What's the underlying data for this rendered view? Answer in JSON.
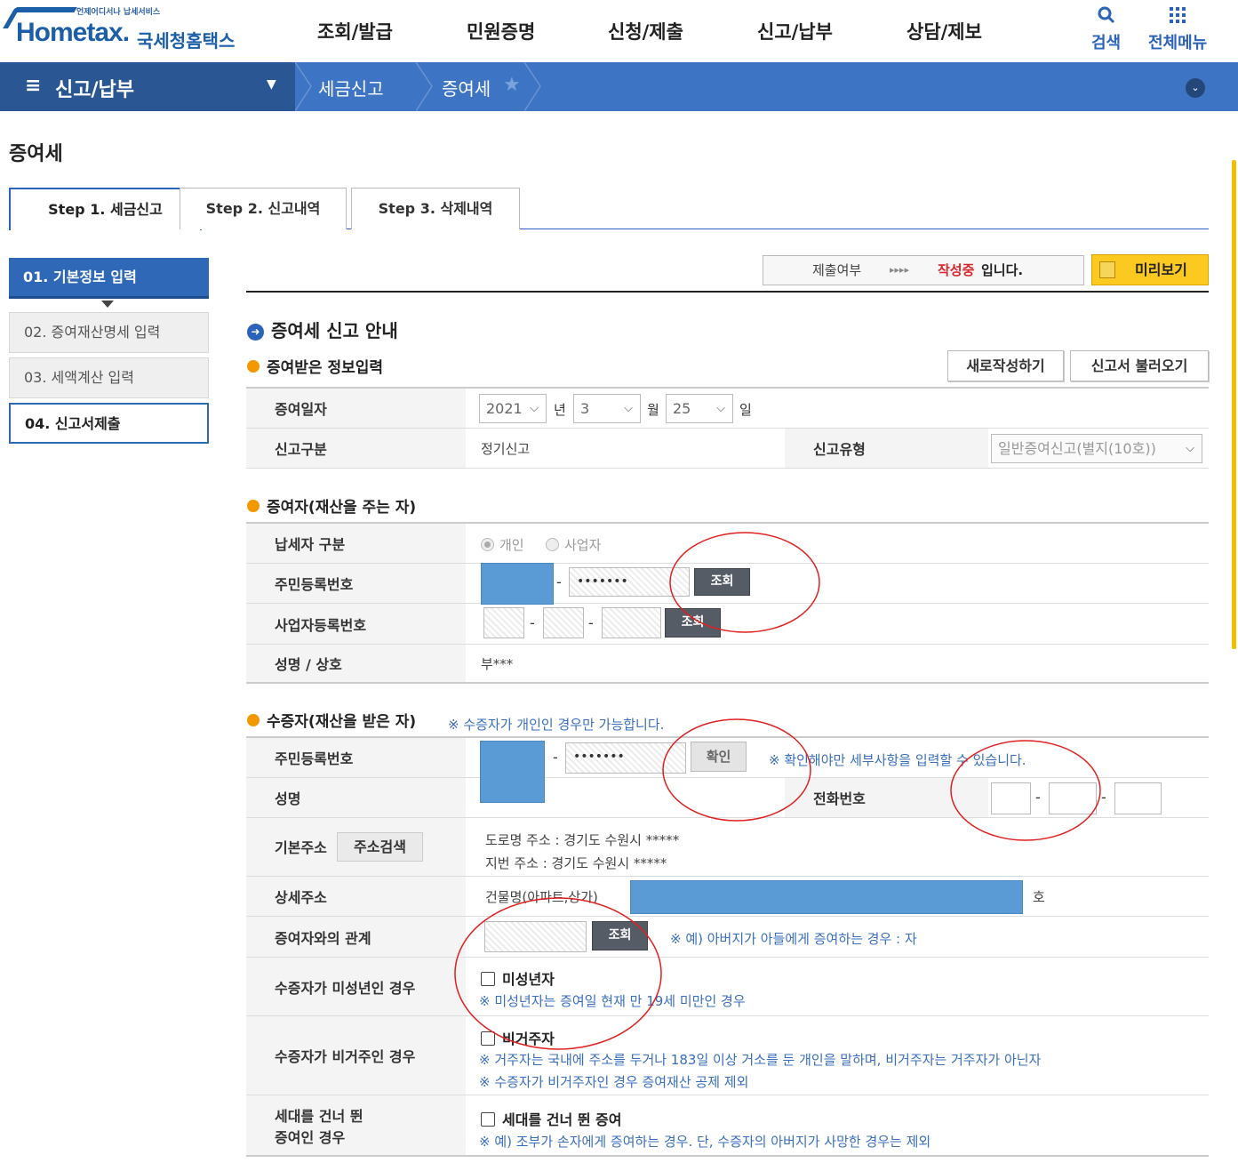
{
  "header": {
    "logo_sub": "언제어디서나 납세서비스",
    "logo_main": "Hometax.",
    "logo_kor": "국세청홈택스",
    "menu": [
      "조회/발급",
      "민원증명",
      "신청/제출",
      "신고/납부",
      "상담/제보"
    ],
    "search_label": "검색",
    "allmenu_label": "전체메뉴"
  },
  "nav": {
    "title": "신고/납부",
    "breadcrumb": [
      "세금신고",
      "증여세"
    ]
  },
  "page_title": "증여세",
  "tabs": [
    "Step 1. 세금신고",
    "Step 2. 신고내역",
    "Step 3. 삭제내역"
  ],
  "side_menu": [
    "01. 기본정보 입력",
    "02. 증여재산명세 입력",
    "03. 세액계산 입력",
    "04. 신고서제출"
  ],
  "status": {
    "label": "제출여부",
    "arrows": "▸▸▸▸",
    "value": "작성중",
    "suffix": "입니다.",
    "preview": "미리보기"
  },
  "section_title": "증여세 신고 안내",
  "info_section": {
    "title": "증여받은 정보입력",
    "new_btn": "새로작성하기",
    "load_btn": "신고서 불러오기",
    "date_label": "증여일자",
    "year": "2021",
    "year_unit": "년",
    "month": "3",
    "month_unit": "월",
    "day": "25",
    "day_unit": "일",
    "type_label": "신고구분",
    "type_value": "정기신고",
    "kind_label": "신고유형",
    "kind_value": "일반증여신고(별지(10호))"
  },
  "donor": {
    "title": "증여자(재산을 주는 자)",
    "taxpayer_label": "납세자 구분",
    "opt_person": "개인",
    "opt_business": "사업자",
    "rrn_label": "주민등록번호",
    "rrn_mask": "•••••••",
    "lookup_btn": "조회",
    "brn_label": "사업자등록번호",
    "lookup_btn2": "조회",
    "name_label": "성명 / 상호",
    "name_value": "부***"
  },
  "donee": {
    "title": "수증자(재산을 받은 자)",
    "title_note": "※ 수증자가 개인인 경우만 가능합니다.",
    "rrn_label": "주민등록번호",
    "rrn_mask": "•••••••",
    "confirm_btn": "확인",
    "confirm_note": "※ 확인해야만 세부사항을 입력할 수 있습니다.",
    "name_label": "성명",
    "phone_label": "전화번호",
    "addr_label": "기본주소",
    "addr_btn": "주소검색",
    "road_addr": "도로명 주소 :  경기도 수원시 *****",
    "lot_addr": "지번 주소 :  경기도 수원시 *****",
    "detail_label": "상세주소",
    "detail_prefix": "건물명(아파트,상가)",
    "detail_suffix": "호",
    "relation_label": "증여자와의 관계",
    "relation_btn": "조회",
    "relation_note": "※ 예) 아버지가 아들에게 증여하는 경우 : 자",
    "minor_label": "수증자가 미성년인 경우",
    "minor_chk": "미성년자",
    "minor_note": "※ 미성년자는 증여일 현재 만 19세 미만인 경우",
    "nonres_label": "수증자가 비거주인 경우",
    "nonres_chk": "비거주자",
    "nonres_note1": "※ 거주자는 국내에 주소를 두거나 183일 이상 거소를 둔 개인을 말하며, 비거주자는 거주자가 아닌자",
    "nonres_note2": "※ 수증자가 비거주자인 경우 증여재산 공제 제외",
    "skip_label1": "세대를 건너 뛴",
    "skip_label2": "증여인 경우",
    "skip_chk": "세대를 건너 뛴 증여",
    "skip_note": "※ 예) 조부가 손자에게 증여하는 경우. 단, 수증자의 아버지가 사망한 경우는 제외"
  },
  "colors": {
    "brand": "#2a63b9",
    "nav": "#3d74c3",
    "alert": "#d9262a",
    "highlight": "#fbc920",
    "annotation": "#e02020"
  }
}
